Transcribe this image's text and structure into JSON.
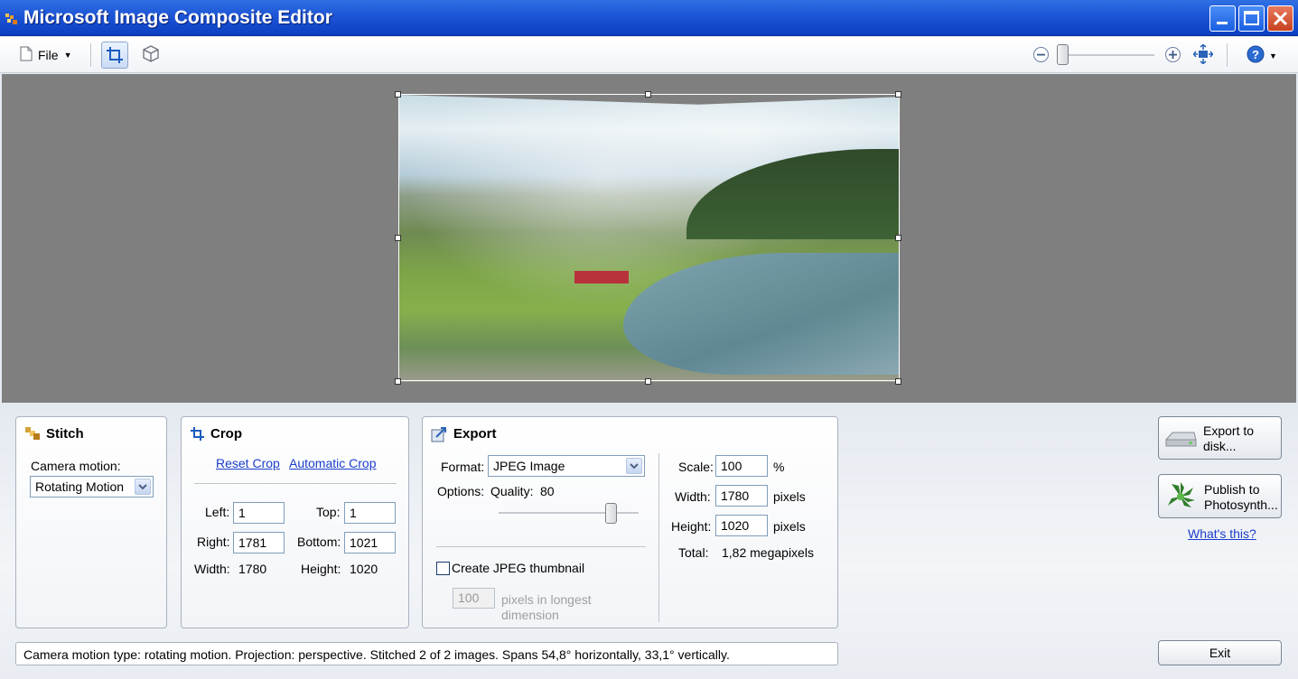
{
  "window": {
    "title": "Microsoft Image Composite Editor"
  },
  "toolbar": {
    "file_label": "File",
    "zoom_level": 0.05
  },
  "stitch": {
    "title": "Stitch",
    "camera_motion_label": "Camera motion:",
    "camera_motion_value": "Rotating Motion"
  },
  "crop": {
    "title": "Crop",
    "reset_crop": "Reset Crop",
    "automatic_crop": "Automatic Crop",
    "left_label": "Left:",
    "left_value": "1",
    "top_label": "Top:",
    "top_value": "1",
    "right_label": "Right:",
    "right_value": "1781",
    "bottom_label": "Bottom:",
    "bottom_value": "1021",
    "width_label": "Width:",
    "width_value": "1780",
    "height_label": "Height:",
    "height_value": "1020"
  },
  "export": {
    "title": "Export",
    "format_label": "Format:",
    "format_value": "JPEG Image",
    "options_label": "Options:",
    "quality_label": "Quality:",
    "quality_value": "80",
    "quality_fraction": 0.8,
    "thumbnail_label": "Create JPEG thumbnail",
    "thumbnail_checked": false,
    "thumbnail_size": "100",
    "thumbnail_unit_line1": "pixels in longest",
    "thumbnail_unit_line2": "dimension",
    "scale_label": "Scale:",
    "scale_value": "100",
    "scale_unit": "%",
    "width_label": "Width:",
    "width_value": "1780",
    "width_unit": "pixels",
    "height_label": "Height:",
    "height_value": "1020",
    "height_unit": "pixels",
    "total_label": "Total:",
    "total_value": "1,82 megapixels"
  },
  "actions": {
    "export_to_disk_line1": "Export to",
    "export_to_disk_line2": "disk...",
    "publish_line1": "Publish to",
    "publish_line2": "Photosynth...",
    "whats_this": "What's this?",
    "exit": "Exit"
  },
  "status": {
    "text": "Camera motion type: rotating motion. Projection: perspective. Stitched 2 of 2 images. Spans 54,8° horizontally, 33,1° vertically."
  },
  "colors": {
    "titlebar": "#1d55d6",
    "canvas": "#7f7f7f",
    "link": "#1a3ecc"
  }
}
